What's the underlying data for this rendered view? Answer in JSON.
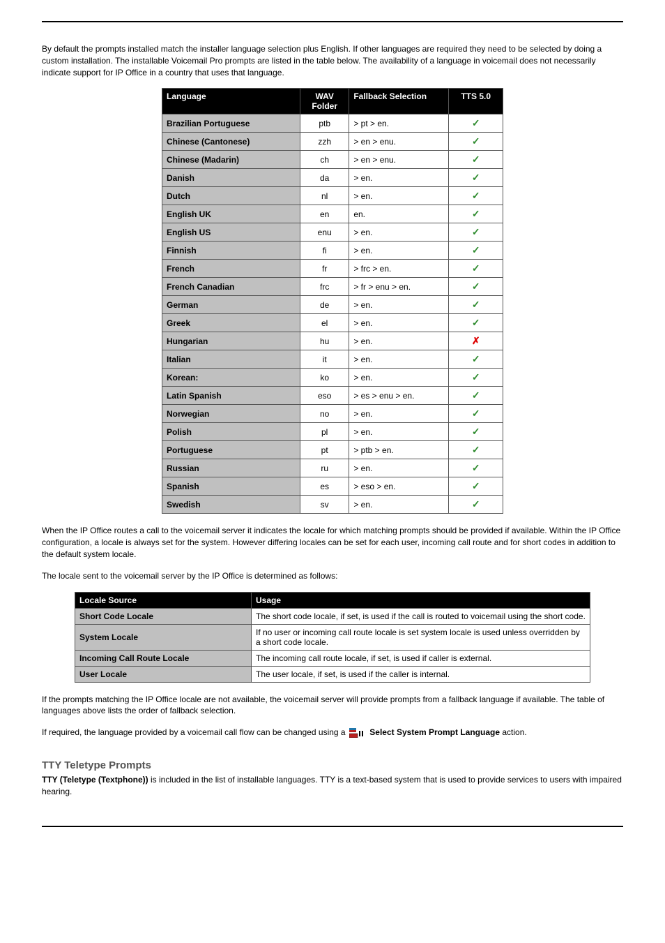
{
  "intro_paragraph": "By default the prompts installed match the installer language selection plus English. If other languages are required they need to be selected by doing a custom installation. The installable Voicemail Pro prompts are listed in the table below. The availability of a language in voicemail does not necessarily indicate support for IP Office in a country that uses that language.",
  "lang_table": {
    "headers": {
      "language": "Language",
      "wav": "WAV Folder",
      "fallback": "Fallback Selection",
      "tts": "TTS 5.0"
    },
    "rows": [
      {
        "language": "Brazilian Portuguese",
        "wav": "ptb",
        "fallback": "> pt > en.",
        "tts": true
      },
      {
        "language": "Chinese (Cantonese)",
        "wav": "zzh",
        "fallback": "> en > enu.",
        "tts": true
      },
      {
        "language": "Chinese (Madarin)",
        "wav": "ch",
        "fallback": "> en > enu.",
        "tts": true
      },
      {
        "language": "Danish",
        "wav": "da",
        "fallback": "> en.",
        "tts": true
      },
      {
        "language": "Dutch",
        "wav": "nl",
        "fallback": "> en.",
        "tts": true
      },
      {
        "language": "English UK",
        "wav": "en",
        "fallback": "en.",
        "tts": true
      },
      {
        "language": "English US",
        "wav": "enu",
        "fallback": "> en.",
        "tts": true
      },
      {
        "language": "Finnish",
        "wav": "fi",
        "fallback": "> en.",
        "tts": true
      },
      {
        "language": "French",
        "wav": "fr",
        "fallback": "> frc > en.",
        "tts": true
      },
      {
        "language": "French Canadian",
        "wav": "frc",
        "fallback": "> fr > enu > en.",
        "tts": true
      },
      {
        "language": "German",
        "wav": "de",
        "fallback": "> en.",
        "tts": true
      },
      {
        "language": "Greek",
        "wav": "el",
        "fallback": "> en.",
        "tts": true
      },
      {
        "language": "Hungarian",
        "wav": "hu",
        "fallback": "> en.",
        "tts": false
      },
      {
        "language": "Italian",
        "wav": "it",
        "fallback": "> en.",
        "tts": true
      },
      {
        "language": "Korean:",
        "wav": "ko",
        "fallback": "> en.",
        "tts": true
      },
      {
        "language": "Latin Spanish",
        "wav": "eso",
        "fallback": "> es > enu > en.",
        "tts": true
      },
      {
        "language": "Norwegian",
        "wav": "no",
        "fallback": "> en.",
        "tts": true
      },
      {
        "language": "Polish",
        "wav": "pl",
        "fallback": "> en.",
        "tts": true
      },
      {
        "language": "Portuguese",
        "wav": "pt",
        "fallback": "> ptb > en.",
        "tts": true
      },
      {
        "language": "Russian",
        "wav": "ru",
        "fallback": "> en.",
        "tts": true
      },
      {
        "language": "Spanish",
        "wav": "es",
        "fallback": "> eso > en.",
        "tts": true
      },
      {
        "language": "Swedish",
        "wav": "sv",
        "fallback": "> en.",
        "tts": true
      }
    ]
  },
  "para_after_lang": "When the IP Office routes a call to the voicemail server it indicates the locale for which matching prompts should be provided if available. Within the IP Office configuration, a locale is always set for the system. However differing locales can be set for each user, incoming call route and for short codes in addition to the default system locale.",
  "para_locale_intro": "The locale sent to the voicemail server by the IP Office is determined as follows:",
  "locale_table": {
    "headers": {
      "source": "Locale Source",
      "usage": "Usage"
    },
    "rows": [
      {
        "source": "Short Code Locale",
        "usage": "The short code locale, if set, is used if the call is routed to voicemail using the short code."
      },
      {
        "source": "System Locale",
        "usage": "If no user or incoming call route locale is set system locale is used unless overridden by a short code locale."
      },
      {
        "source": "Incoming Call Route Locale",
        "usage": "The incoming call route locale, if set, is used if caller is external."
      },
      {
        "source": "User Locale",
        "usage": "The user locale, if set, is used if the caller is internal."
      }
    ]
  },
  "para_after_locale": "If the prompts matching the IP Office locale are not available, the voicemail server will provide prompts from a fallback language if available. The table of languages above lists the order of fallback selection.",
  "action_sentence": {
    "prefix": "If required, the language provided by a voicemail call flow can be changed using a ",
    "action_label": "Select System Prompt Language",
    "suffix": " action."
  },
  "tty": {
    "heading": "TTY Teletype Prompts",
    "lead_bold": "TTY (Teletype (Textphone))",
    "body": " is included in the list of installable languages. TTY is a text-based system that is used to provide services to users with impaired hearing."
  }
}
